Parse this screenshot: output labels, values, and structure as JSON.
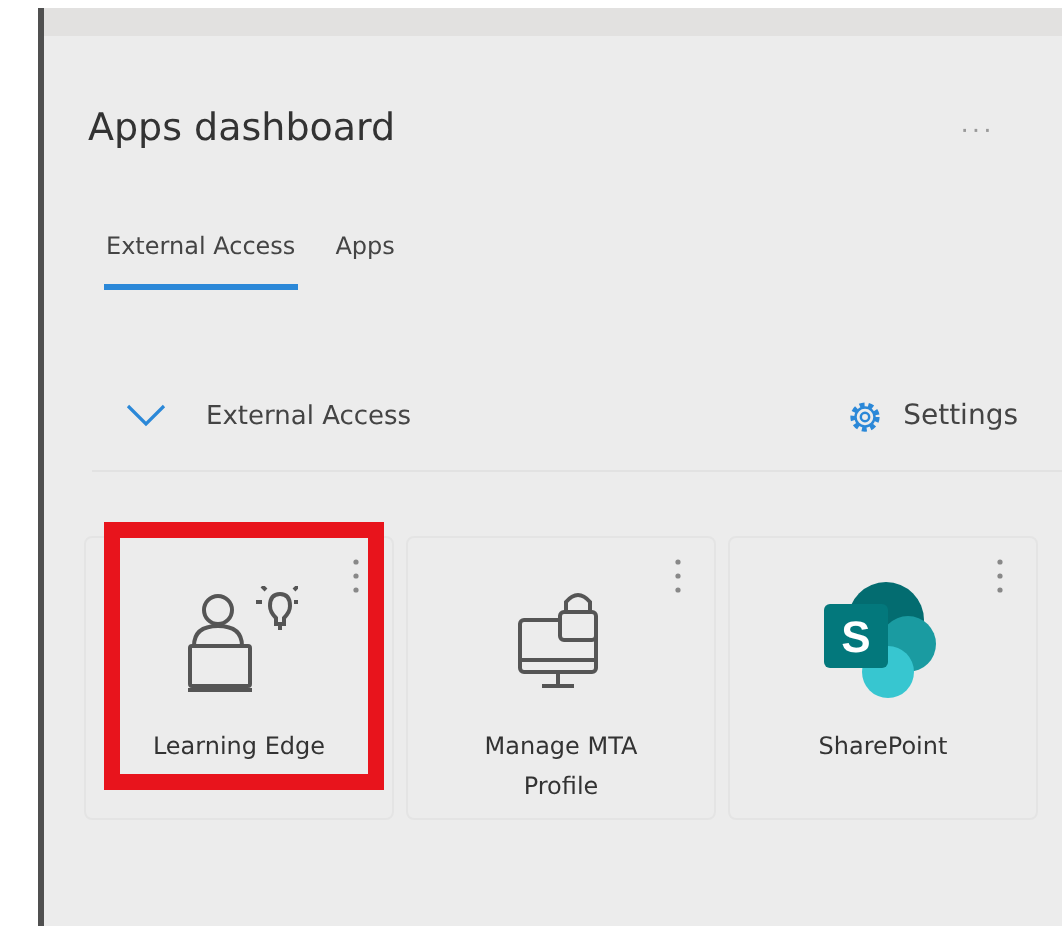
{
  "panel": {
    "title": "Apps dashboard",
    "more_label": "···"
  },
  "tabs": [
    {
      "label": "External Access",
      "selected": true
    },
    {
      "label": "Apps",
      "selected": false
    }
  ],
  "section": {
    "title": "External Access",
    "expanded": true,
    "settings_label": "Settings"
  },
  "apps": [
    {
      "name": "Learning Edge",
      "kind": "learner",
      "highlighted": true
    },
    {
      "name": "Manage MTA Profile",
      "kind": "monitor-lock",
      "highlighted": false
    },
    {
      "name": "SharePoint",
      "kind": "sharepoint",
      "logo_letter": "S",
      "highlighted": false
    }
  ]
}
